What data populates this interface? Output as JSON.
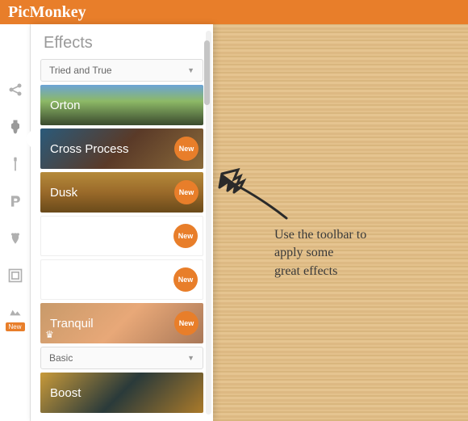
{
  "app": {
    "logo": "PicMonkey"
  },
  "toolbar": {
    "tools": [
      {
        "name": "share-icon"
      },
      {
        "name": "effects-icon",
        "active": true
      },
      {
        "name": "touchup-icon"
      },
      {
        "name": "text-icon"
      },
      {
        "name": "overlays-icon"
      },
      {
        "name": "frames-icon"
      },
      {
        "name": "textures-icon",
        "new": true
      }
    ],
    "new_label": "New"
  },
  "panel": {
    "title": "Effects",
    "group1_label": "Tried and True",
    "group2_label": "Basic",
    "new_badge": "New",
    "effects_group1": [
      {
        "label": "Orton",
        "bg": "bg-orton",
        "new": false
      },
      {
        "label": "Cross Process",
        "bg": "bg-cross",
        "new": true
      },
      {
        "label": "Dusk",
        "bg": "bg-dusk",
        "new": true
      },
      {
        "label": "",
        "bg": "",
        "new": true,
        "blank": true
      },
      {
        "label": "",
        "bg": "",
        "new": true,
        "blank": true
      },
      {
        "label": "Tranquil",
        "bg": "bg-tranquil",
        "new": true,
        "crown": true
      }
    ],
    "effects_group2": [
      {
        "label": "Boost",
        "bg": "bg-boost",
        "new": false
      }
    ]
  },
  "annotation": {
    "line1": "Use the toolbar to",
    "line2": "apply some",
    "line3": "great effects"
  },
  "colors": {
    "accent": "#e87e2a"
  }
}
